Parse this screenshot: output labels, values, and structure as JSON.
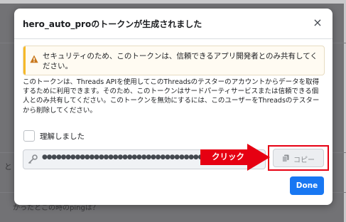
{
  "modal": {
    "title": "hero_auto_proのトークンが生成されました",
    "close_glyph": "×",
    "warning": "セキュリティのため、このトークンは、信頼できるアプリ開発者とのみ共有してください。",
    "description": "このトークンは、Threads APIを使用してこのThreadsのテスターのアカウントからデータを取得するために利用できます。そのため、このトークンはサードパーティサービスまたは信頼できる個人とのみ共有してください。このトークンを無効にするには、このユーザーをThreadsのテスターから削除してください。",
    "checkbox_label": "理解しました",
    "token_masked": "●●●●●●●●●●●●●●●●●●●●●●●●●●●●●●●●●●●●●●●●●●●●●●●●●●●●●●●",
    "copy_label": "コピー",
    "done_label": "Done"
  },
  "annotation": {
    "arrow_label": "クリック",
    "color": "#e60012"
  },
  "background": {
    "left_fragment": "と",
    "bottom_fragment": "かったとこの時のpingは？"
  },
  "colors": {
    "primary": "#1877f2",
    "warning": "#f7b928",
    "annotation": "#e60012"
  }
}
